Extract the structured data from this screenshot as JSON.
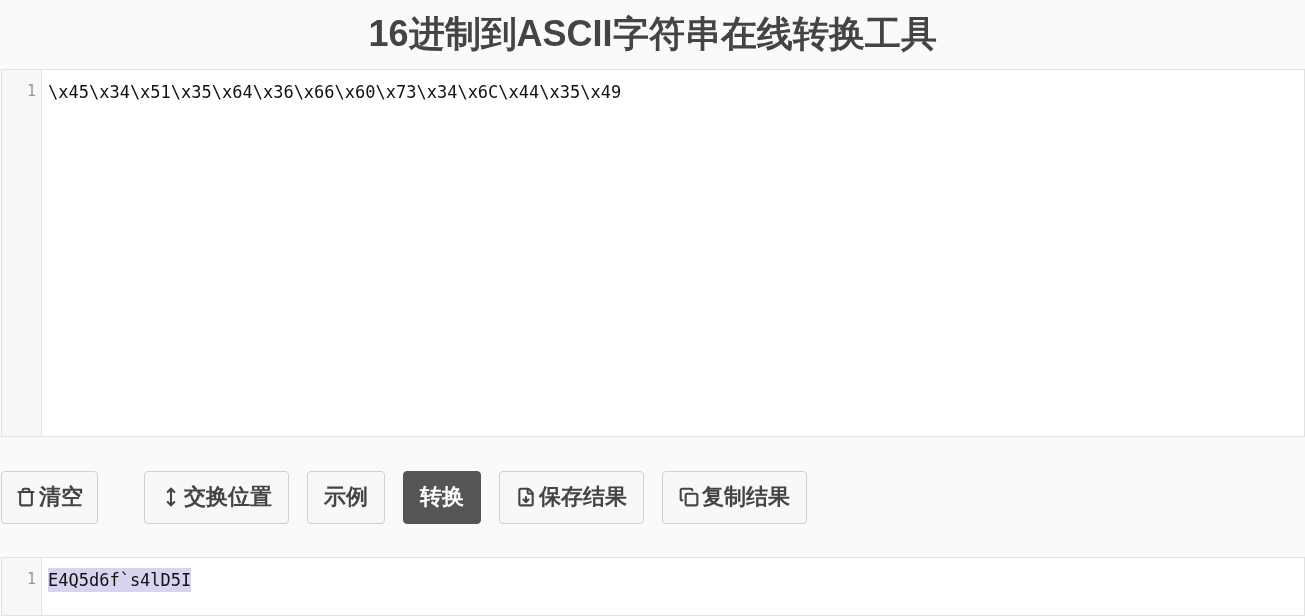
{
  "title": "16进制到ASCII字符串在线转换工具",
  "input_editor": {
    "lines": [
      {
        "number": "1",
        "text": "\\x45\\x34\\x51\\x35\\x64\\x36\\x66\\x60\\x73\\x34\\x6C\\x44\\x35\\x49",
        "selected": false
      }
    ]
  },
  "buttons": [
    {
      "label": "清空",
      "kind": "clear",
      "primary": false
    },
    {
      "label": "交换位置",
      "kind": "swap",
      "primary": false
    },
    {
      "label": "示例",
      "kind": "example",
      "primary": false
    },
    {
      "label": "转换",
      "kind": "convert",
      "primary": true
    },
    {
      "label": "保存结果",
      "kind": "save",
      "primary": false
    },
    {
      "label": "复制结果",
      "kind": "copy",
      "primary": false
    }
  ],
  "output_editor": {
    "lines": [
      {
        "number": "1",
        "text": "E4Q5d6f`s4lD5I",
        "selected": true
      }
    ]
  }
}
